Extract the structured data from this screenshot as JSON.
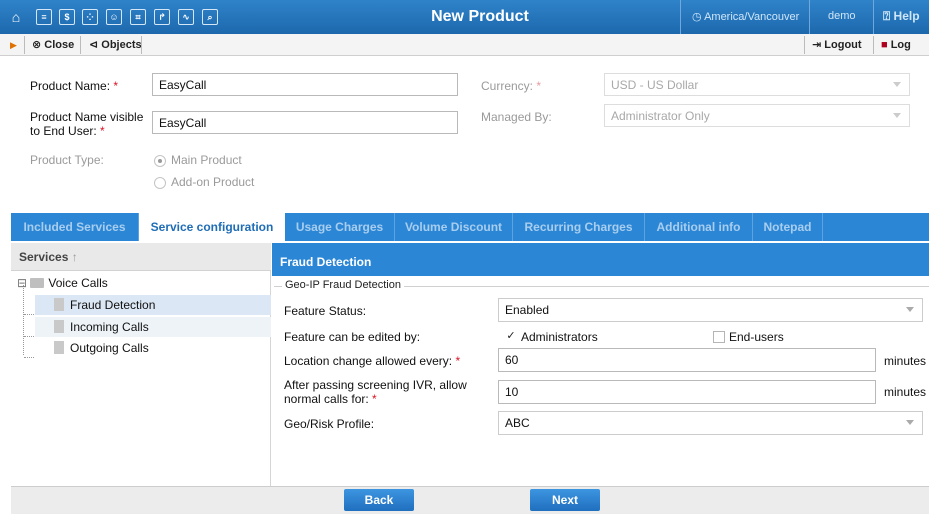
{
  "header": {
    "title": "New Product",
    "timezone": "America/Vancouver",
    "user": "demo",
    "help": "Help"
  },
  "toolbar": {
    "close": "Close",
    "objects": "Objects",
    "logout": "Logout",
    "log": "Log"
  },
  "form": {
    "product_name_label": "Product Name:",
    "product_name_value": "EasyCall",
    "product_name_visible_label_1": "Product Name visible",
    "product_name_visible_label_2": "to End User:",
    "product_name_visible_value": "EasyCall",
    "product_type_label": "Product Type:",
    "product_type_main": "Main Product",
    "product_type_addon": "Add-on Product",
    "currency_label": "Currency:",
    "currency_value": "USD - US Dollar",
    "managed_by_label": "Managed By:",
    "managed_by_value": "Administrator Only",
    "required_mark": "*"
  },
  "tabs": [
    {
      "label": "Included Services",
      "active": false
    },
    {
      "label": "Service configuration",
      "active": true
    },
    {
      "label": "Usage Charges",
      "active": false
    },
    {
      "label": "Volume Discount",
      "active": false
    },
    {
      "label": "Recurring Charges",
      "active": false
    },
    {
      "label": "Additional info",
      "active": false
    },
    {
      "label": "Notepad",
      "active": false
    }
  ],
  "services": {
    "header": "Services",
    "root": "Voice Calls",
    "items": [
      "Fraud Detection",
      "Incoming Calls",
      "Outgoing Calls"
    ],
    "selected": "Fraud Detection"
  },
  "fraud": {
    "header": "Fraud Detection",
    "legend": "Geo-IP Fraud Detection",
    "feature_status_label": "Feature Status:",
    "feature_status_value": "Enabled",
    "editable_by_label": "Feature can be edited by:",
    "editable_admins": "Administrators",
    "editable_admins_checked": true,
    "editable_endusers": "End-users",
    "editable_endusers_checked": false,
    "location_change_label": "Location change allowed every:",
    "location_change_value": "60",
    "location_change_unit": "minutes",
    "ivr_label_1": "After passing screening IVR, allow",
    "ivr_label_2": "normal calls for:",
    "ivr_value": "10",
    "ivr_unit": "minutes",
    "georisk_label": "Geo/Risk Profile:",
    "georisk_value": "ABC"
  },
  "footer": {
    "back": "Back",
    "next": "Next"
  },
  "colors": {
    "brand_blue": "#2b87d6",
    "required_red": "#dd1122"
  }
}
